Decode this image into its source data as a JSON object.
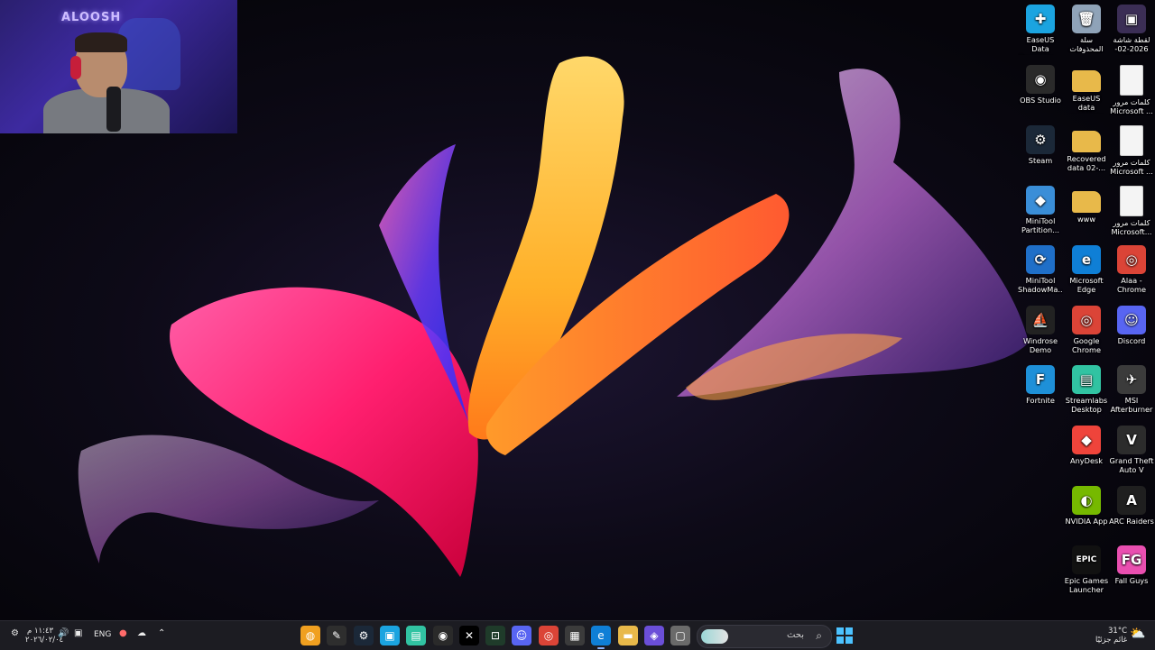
{
  "webcam": {
    "overlay_text": "ALOOSH"
  },
  "desktop": {
    "icons": [
      {
        "col": 0,
        "row": 0,
        "label": "EaseUS Data Recovery ...",
        "icon": "easeus-icon",
        "color": "#1ba4e0",
        "glyph": "✚"
      },
      {
        "col": 1,
        "row": 0,
        "label": "سلة المحذوفات",
        "icon": "recycle-bin-icon",
        "color": "#8fa3b8",
        "glyph": "🗑"
      },
      {
        "col": 2,
        "row": 0,
        "label": "لقطة شاشة 2026-02-0...",
        "icon": "screenshot-file-icon",
        "color": "#3b2e55",
        "glyph": "▣"
      },
      {
        "col": 0,
        "row": 1,
        "label": "OBS Studio",
        "icon": "obs-icon",
        "color": "#2a2a2a",
        "glyph": "◉"
      },
      {
        "col": 1,
        "row": 1,
        "label": "EaseUS data recovery",
        "icon": "folder-icon",
        "color": "#e8b94a",
        "glyph": ""
      },
      {
        "col": 2,
        "row": 1,
        "label": "كلمات مرور Microsoft ...",
        "icon": "document-icon",
        "color": "#f4f4f4",
        "glyph": ""
      },
      {
        "col": 0,
        "row": 2,
        "label": "Steam",
        "icon": "steam-icon",
        "color": "#1b2838",
        "glyph": "⚙"
      },
      {
        "col": 1,
        "row": 2,
        "label": "Recovered data 02-...",
        "icon": "folder-icon",
        "color": "#e8b94a",
        "glyph": ""
      },
      {
        "col": 2,
        "row": 2,
        "label": "كلمات مرور Microsoft ...",
        "icon": "document-icon",
        "color": "#f4f4f4",
        "glyph": ""
      },
      {
        "col": 0,
        "row": 3,
        "label": "MiniTool Partition...",
        "icon": "minitool-partition-icon",
        "color": "#3a8ed8",
        "glyph": "◆"
      },
      {
        "col": 1,
        "row": 3,
        "label": "www",
        "icon": "folder-icon",
        "color": "#e8b94a",
        "glyph": ""
      },
      {
        "col": 2,
        "row": 3,
        "label": "كلمات مرور Microsoft...",
        "icon": "document-icon",
        "color": "#f4f4f4",
        "glyph": ""
      },
      {
        "col": 0,
        "row": 4,
        "label": "MiniTool ShadowMa...",
        "icon": "minitool-shadowmaker-icon",
        "color": "#1f6fc8",
        "glyph": "⟳"
      },
      {
        "col": 1,
        "row": 4,
        "label": "Microsoft Edge",
        "icon": "edge-icon",
        "color": "#0f7fd6",
        "glyph": "e"
      },
      {
        "col": 2,
        "row": 4,
        "label": "Alaa - Chrome",
        "icon": "chrome-profile-icon",
        "color": "#db4437",
        "glyph": "◎"
      },
      {
        "col": 0,
        "row": 5,
        "label": "Windrose Demo",
        "icon": "windrose-icon",
        "color": "#222222",
        "glyph": "⛵"
      },
      {
        "col": 1,
        "row": 5,
        "label": "Google Chrome",
        "icon": "chrome-icon",
        "color": "#db4437",
        "glyph": "◎"
      },
      {
        "col": 2,
        "row": 5,
        "label": "Discord",
        "icon": "discord-icon",
        "color": "#5865f2",
        "glyph": "☺"
      },
      {
        "col": 0,
        "row": 6,
        "label": "Fortnite",
        "icon": "fortnite-icon",
        "color": "#1e90d8",
        "glyph": "F"
      },
      {
        "col": 1,
        "row": 6,
        "label": "Streamlabs Desktop",
        "icon": "streamlabs-icon",
        "color": "#31c3a2",
        "glyph": "▤"
      },
      {
        "col": 2,
        "row": 6,
        "label": "MSI Afterburner",
        "icon": "msi-afterburner-icon",
        "color": "#3b3b3b",
        "glyph": "✈"
      },
      {
        "col": 1,
        "row": 7,
        "label": "AnyDesk",
        "icon": "anydesk-icon",
        "color": "#ef443b",
        "glyph": "◆"
      },
      {
        "col": 2,
        "row": 7,
        "label": "Grand Theft Auto V",
        "icon": "gta-icon",
        "color": "#2c2c2c",
        "glyph": "V"
      },
      {
        "col": 1,
        "row": 8,
        "label": "NVIDIA App",
        "icon": "nvidia-icon",
        "color": "#76b900",
        "glyph": "◐"
      },
      {
        "col": 2,
        "row": 8,
        "label": "ARC Raiders",
        "icon": "arc-raiders-icon",
        "color": "#1f1f1f",
        "glyph": "A"
      },
      {
        "col": 1,
        "row": 9,
        "label": "Epic Games Launcher",
        "icon": "epic-games-icon",
        "color": "#111111",
        "glyph": "EPIC"
      },
      {
        "col": 2,
        "row": 9,
        "label": "Fall Guys",
        "icon": "fall-guys-icon",
        "color": "#e94fb0",
        "glyph": "FG"
      }
    ]
  },
  "taskbar": {
    "search_placeholder": "بحث",
    "start_icon": "windows-start-icon",
    "apps": [
      {
        "name": "chromium-app-icon",
        "color": "#f0a020",
        "glyph": "◍"
      },
      {
        "name": "pen-tool-app-icon",
        "color": "#2e2e2e",
        "glyph": "✎"
      },
      {
        "name": "steam-taskbar-icon",
        "color": "#1b2838",
        "glyph": "⚙"
      },
      {
        "name": "easeus-taskbar-icon",
        "color": "#1ba4e0",
        "glyph": "▣"
      },
      {
        "name": "streamlabs-taskbar-icon",
        "color": "#31c3a2",
        "glyph": "▤"
      },
      {
        "name": "obs-taskbar-icon",
        "color": "#2a2a2a",
        "glyph": "◉"
      },
      {
        "name": "x-app-icon",
        "color": "#000000",
        "glyph": "✕"
      },
      {
        "name": "terminal-app-icon",
        "color": "#1f3b2a",
        "glyph": "⊡"
      },
      {
        "name": "discord-taskbar-icon",
        "color": "#5865f2",
        "glyph": "☺"
      },
      {
        "name": "chrome-taskbar-icon",
        "color": "#db4437",
        "glyph": "◎"
      },
      {
        "name": "store-app-icon",
        "color": "#3b3b3b",
        "glyph": "▦"
      },
      {
        "name": "edge-taskbar-icon",
        "color": "#0f7fd6",
        "glyph": "e"
      },
      {
        "name": "file-explorer-icon",
        "color": "#e8b94a",
        "glyph": "▬"
      },
      {
        "name": "m365-app-icon",
        "color": "#6b4fd8",
        "glyph": "◈"
      },
      {
        "name": "window-app-icon",
        "color": "#6a6a6a",
        "glyph": "▢"
      }
    ],
    "tray": {
      "language": "ENG",
      "time": "١١:٤٣ م",
      "date": "٢٠٢٦/٠٢/٠٤",
      "weather_temp": "31°C",
      "weather_text": "غائم جزئيًا"
    }
  }
}
